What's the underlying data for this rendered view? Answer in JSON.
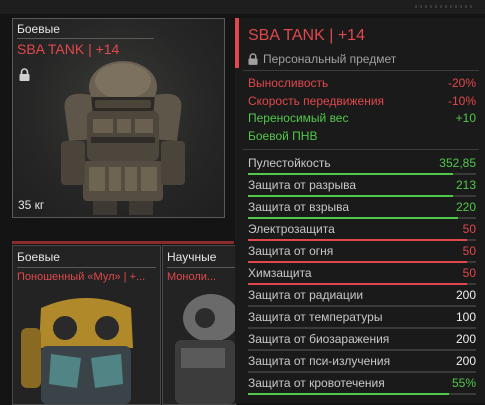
{
  "colors": {
    "red": "#e0484c",
    "green": "#52c84a",
    "white": "#f0f0f0",
    "muted": "#a0a0a0"
  },
  "main_card": {
    "category": "Боевые",
    "name": "SBA TANK | +14",
    "weight": "35 кг",
    "lock_icon": "lock-icon"
  },
  "sub_cards": [
    {
      "category": "Боевые",
      "name": "Поношенный «Мул» | +..."
    },
    {
      "category": "Научные",
      "name": "Моноли..."
    }
  ],
  "panel": {
    "title": "SBA TANK | +14",
    "subtitle": "Персональный предмет",
    "modifiers": [
      {
        "label": "Выносливость",
        "value": "-20%",
        "color": "red"
      },
      {
        "label": "Скорость передвижения",
        "value": "-10%",
        "color": "red"
      },
      {
        "label": "Переносимый вес",
        "value": "+10",
        "color": "green"
      },
      {
        "label": "Боевой ПНВ",
        "value": "",
        "color": "green"
      }
    ],
    "stats": [
      {
        "label": "Пулестойкость",
        "value": "352,85",
        "color": "green",
        "level": 0.9
      },
      {
        "label": "Защита от разрыва",
        "value": "213",
        "color": "green",
        "level": 0.9
      },
      {
        "label": "Защита от взрыва",
        "value": "220",
        "color": "green",
        "level": 0.92
      },
      {
        "label": "Электрозащита",
        "value": "50",
        "color": "red",
        "level": 0.96
      },
      {
        "label": "Защита от огня",
        "value": "50",
        "color": "red",
        "level": 0.96
      },
      {
        "label": "Химзащита",
        "value": "50",
        "color": "red",
        "level": 0.96
      },
      {
        "label": "Защита от радиации",
        "value": "200",
        "color": "white",
        "level": 0
      },
      {
        "label": "Защита от температуры",
        "value": "100",
        "color": "white",
        "level": 0
      },
      {
        "label": "Защита от биозаражения",
        "value": "200",
        "color": "white",
        "level": 0
      },
      {
        "label": "Защита от пси-излучения",
        "value": "200",
        "color": "white",
        "level": 0
      },
      {
        "label": "Защита от кровотечения",
        "value": "55%",
        "color": "green",
        "level": 0.88
      }
    ]
  }
}
